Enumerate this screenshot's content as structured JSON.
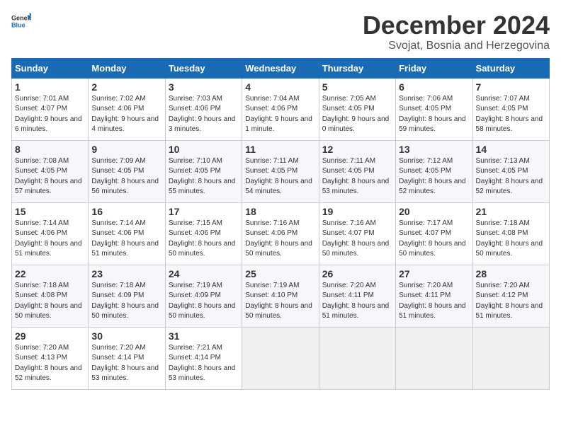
{
  "logo": {
    "general": "General",
    "blue": "Blue"
  },
  "title": "December 2024",
  "subtitle": "Svojat, Bosnia and Herzegovina",
  "weekdays": [
    "Sunday",
    "Monday",
    "Tuesday",
    "Wednesday",
    "Thursday",
    "Friday",
    "Saturday"
  ],
  "weeks": [
    [
      {
        "day": "1",
        "sunrise": "Sunrise: 7:01 AM",
        "sunset": "Sunset: 4:07 PM",
        "daylight": "Daylight: 9 hours and 6 minutes."
      },
      {
        "day": "2",
        "sunrise": "Sunrise: 7:02 AM",
        "sunset": "Sunset: 4:06 PM",
        "daylight": "Daylight: 9 hours and 4 minutes."
      },
      {
        "day": "3",
        "sunrise": "Sunrise: 7:03 AM",
        "sunset": "Sunset: 4:06 PM",
        "daylight": "Daylight: 9 hours and 3 minutes."
      },
      {
        "day": "4",
        "sunrise": "Sunrise: 7:04 AM",
        "sunset": "Sunset: 4:06 PM",
        "daylight": "Daylight: 9 hours and 1 minute."
      },
      {
        "day": "5",
        "sunrise": "Sunrise: 7:05 AM",
        "sunset": "Sunset: 4:05 PM",
        "daylight": "Daylight: 9 hours and 0 minutes."
      },
      {
        "day": "6",
        "sunrise": "Sunrise: 7:06 AM",
        "sunset": "Sunset: 4:05 PM",
        "daylight": "Daylight: 8 hours and 59 minutes."
      },
      {
        "day": "7",
        "sunrise": "Sunrise: 7:07 AM",
        "sunset": "Sunset: 4:05 PM",
        "daylight": "Daylight: 8 hours and 58 minutes."
      }
    ],
    [
      {
        "day": "8",
        "sunrise": "Sunrise: 7:08 AM",
        "sunset": "Sunset: 4:05 PM",
        "daylight": "Daylight: 8 hours and 57 minutes."
      },
      {
        "day": "9",
        "sunrise": "Sunrise: 7:09 AM",
        "sunset": "Sunset: 4:05 PM",
        "daylight": "Daylight: 8 hours and 56 minutes."
      },
      {
        "day": "10",
        "sunrise": "Sunrise: 7:10 AM",
        "sunset": "Sunset: 4:05 PM",
        "daylight": "Daylight: 8 hours and 55 minutes."
      },
      {
        "day": "11",
        "sunrise": "Sunrise: 7:11 AM",
        "sunset": "Sunset: 4:05 PM",
        "daylight": "Daylight: 8 hours and 54 minutes."
      },
      {
        "day": "12",
        "sunrise": "Sunrise: 7:11 AM",
        "sunset": "Sunset: 4:05 PM",
        "daylight": "Daylight: 8 hours and 53 minutes."
      },
      {
        "day": "13",
        "sunrise": "Sunrise: 7:12 AM",
        "sunset": "Sunset: 4:05 PM",
        "daylight": "Daylight: 8 hours and 52 minutes."
      },
      {
        "day": "14",
        "sunrise": "Sunrise: 7:13 AM",
        "sunset": "Sunset: 4:05 PM",
        "daylight": "Daylight: 8 hours and 52 minutes."
      }
    ],
    [
      {
        "day": "15",
        "sunrise": "Sunrise: 7:14 AM",
        "sunset": "Sunset: 4:06 PM",
        "daylight": "Daylight: 8 hours and 51 minutes."
      },
      {
        "day": "16",
        "sunrise": "Sunrise: 7:14 AM",
        "sunset": "Sunset: 4:06 PM",
        "daylight": "Daylight: 8 hours and 51 minutes."
      },
      {
        "day": "17",
        "sunrise": "Sunrise: 7:15 AM",
        "sunset": "Sunset: 4:06 PM",
        "daylight": "Daylight: 8 hours and 50 minutes."
      },
      {
        "day": "18",
        "sunrise": "Sunrise: 7:16 AM",
        "sunset": "Sunset: 4:06 PM",
        "daylight": "Daylight: 8 hours and 50 minutes."
      },
      {
        "day": "19",
        "sunrise": "Sunrise: 7:16 AM",
        "sunset": "Sunset: 4:07 PM",
        "daylight": "Daylight: 8 hours and 50 minutes."
      },
      {
        "day": "20",
        "sunrise": "Sunrise: 7:17 AM",
        "sunset": "Sunset: 4:07 PM",
        "daylight": "Daylight: 8 hours and 50 minutes."
      },
      {
        "day": "21",
        "sunrise": "Sunrise: 7:18 AM",
        "sunset": "Sunset: 4:08 PM",
        "daylight": "Daylight: 8 hours and 50 minutes."
      }
    ],
    [
      {
        "day": "22",
        "sunrise": "Sunrise: 7:18 AM",
        "sunset": "Sunset: 4:08 PM",
        "daylight": "Daylight: 8 hours and 50 minutes."
      },
      {
        "day": "23",
        "sunrise": "Sunrise: 7:18 AM",
        "sunset": "Sunset: 4:09 PM",
        "daylight": "Daylight: 8 hours and 50 minutes."
      },
      {
        "day": "24",
        "sunrise": "Sunrise: 7:19 AM",
        "sunset": "Sunset: 4:09 PM",
        "daylight": "Daylight: 8 hours and 50 minutes."
      },
      {
        "day": "25",
        "sunrise": "Sunrise: 7:19 AM",
        "sunset": "Sunset: 4:10 PM",
        "daylight": "Daylight: 8 hours and 50 minutes."
      },
      {
        "day": "26",
        "sunrise": "Sunrise: 7:20 AM",
        "sunset": "Sunset: 4:11 PM",
        "daylight": "Daylight: 8 hours and 51 minutes."
      },
      {
        "day": "27",
        "sunrise": "Sunrise: 7:20 AM",
        "sunset": "Sunset: 4:11 PM",
        "daylight": "Daylight: 8 hours and 51 minutes."
      },
      {
        "day": "28",
        "sunrise": "Sunrise: 7:20 AM",
        "sunset": "Sunset: 4:12 PM",
        "daylight": "Daylight: 8 hours and 51 minutes."
      }
    ],
    [
      {
        "day": "29",
        "sunrise": "Sunrise: 7:20 AM",
        "sunset": "Sunset: 4:13 PM",
        "daylight": "Daylight: 8 hours and 52 minutes."
      },
      {
        "day": "30",
        "sunrise": "Sunrise: 7:20 AM",
        "sunset": "Sunset: 4:14 PM",
        "daylight": "Daylight: 8 hours and 53 minutes."
      },
      {
        "day": "31",
        "sunrise": "Sunrise: 7:21 AM",
        "sunset": "Sunset: 4:14 PM",
        "daylight": "Daylight: 8 hours and 53 minutes."
      },
      null,
      null,
      null,
      null
    ]
  ]
}
